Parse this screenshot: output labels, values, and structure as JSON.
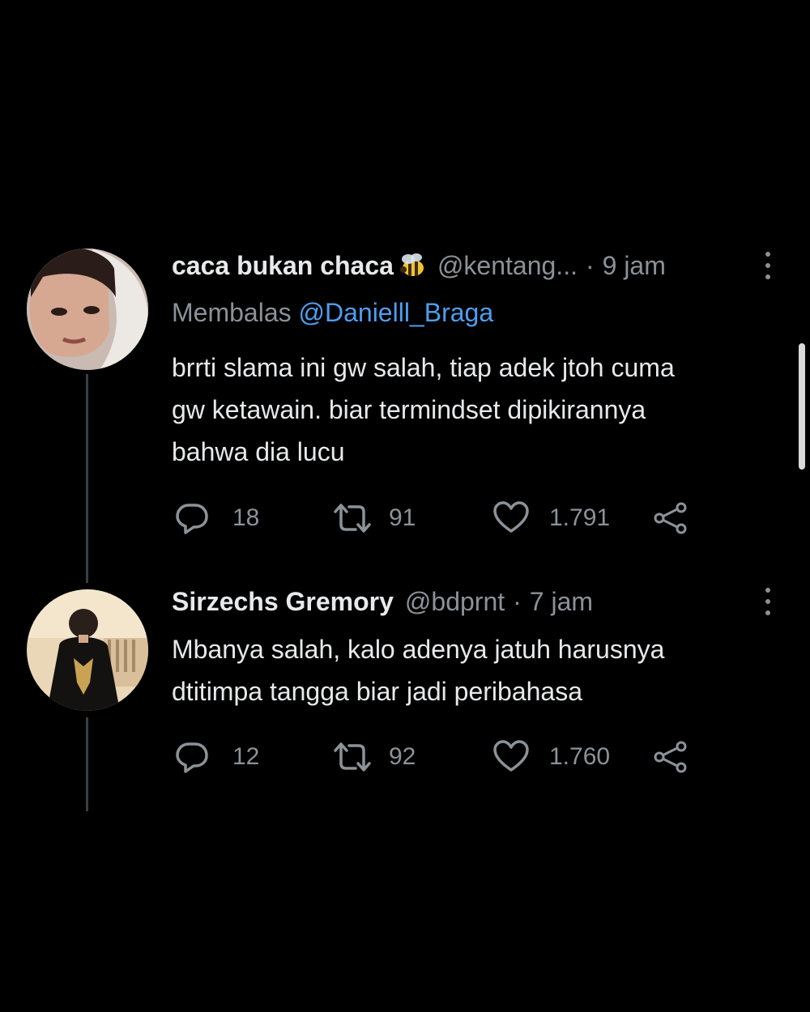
{
  "tweets": [
    {
      "display_name": "caca bukan chaca",
      "badge_icon": "bee-icon",
      "handle": "@kentang...",
      "separator": "·",
      "time": "9 jam",
      "reply_label": "Membalas",
      "reply_mention": "@Danielll_Braga",
      "text_lines": [
        "brrti slama ini gw salah, tiap adek jtoh cuma",
        "gw ketawain. biar termindset dipikirannya",
        "bahwa dia lucu"
      ],
      "replies": "18",
      "retweets": "91",
      "likes": "1.791"
    },
    {
      "display_name": "Sirzechs Gremory",
      "handle": "@bdprnt",
      "separator": "·",
      "time": "7 jam",
      "text_lines": [
        "Mbanya salah, kalo adenya jatuh harusnya",
        "dtitimpa tangga biar jadi peribahasa"
      ],
      "replies": "12",
      "retweets": "92",
      "likes": "1.760"
    }
  ],
  "icons": {
    "reply": "reply-icon",
    "retweet": "retweet-icon",
    "like": "heart-icon",
    "share": "share-icon",
    "more": "more-options-icon"
  },
  "colors": {
    "background": "#000000",
    "text": "#e7e9ea",
    "secondary": "#8b9298",
    "link": "#4e9ef0",
    "thread_line": "#3a3f44"
  }
}
